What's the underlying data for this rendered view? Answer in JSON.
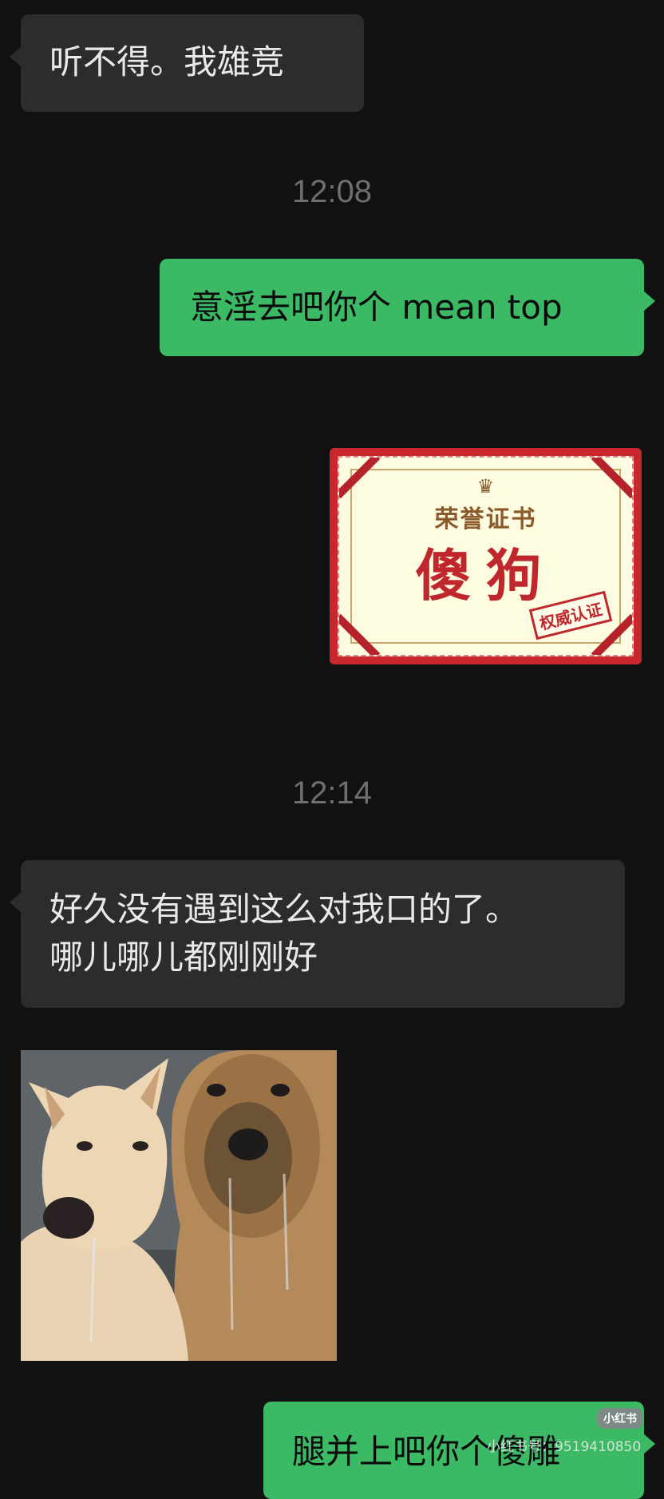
{
  "messages": {
    "m1": {
      "text": "听不得。我雄竞"
    },
    "t1": {
      "time": "12:08"
    },
    "m2": {
      "text": "意淫去吧你个 mean top"
    },
    "sticker": {
      "crown": "♛",
      "title": "荣誉证书",
      "main": "傻狗",
      "stamp": "权威认证"
    },
    "t2": {
      "time": "12:14"
    },
    "m3": {
      "line1": "好久没有遇到这么对我口的了。",
      "line2": "哪儿哪儿都刚刚好"
    },
    "m4": {
      "text": "腿并上吧你个傻雕"
    }
  },
  "watermark": {
    "badge": "小红书",
    "text": "小红书号：9519410850"
  },
  "colors": {
    "background": "#111111",
    "incoming_bubble": "#2c2c2c",
    "outgoing_bubble": "#3bb964",
    "timestamp": "#6f6f6f"
  }
}
